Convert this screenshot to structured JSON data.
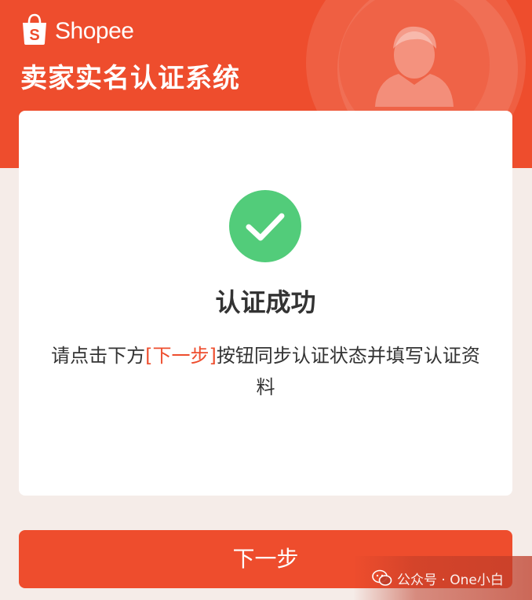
{
  "header": {
    "brand_name": "Shopee",
    "logo_letter": "S",
    "system_title": "卖家实名认证系统"
  },
  "result": {
    "title": "认证成功",
    "instruction_prefix": "请点击下方",
    "instruction_highlight": "[下一步]",
    "instruction_suffix": "按钮同步认证状态并填写认证资料"
  },
  "actions": {
    "next_label": "下一步"
  },
  "watermark": {
    "text": "公众号 · One小白"
  },
  "colors": {
    "brand": "#ee4d2d",
    "success": "#52cc7a",
    "background": "#f5ece8",
    "text": "#333333"
  },
  "icons": {
    "brand_logo": "shopee-bag-icon",
    "success": "check-circle-icon",
    "header_decoration": "person-avatar-icon",
    "watermark": "wechat-icon"
  }
}
